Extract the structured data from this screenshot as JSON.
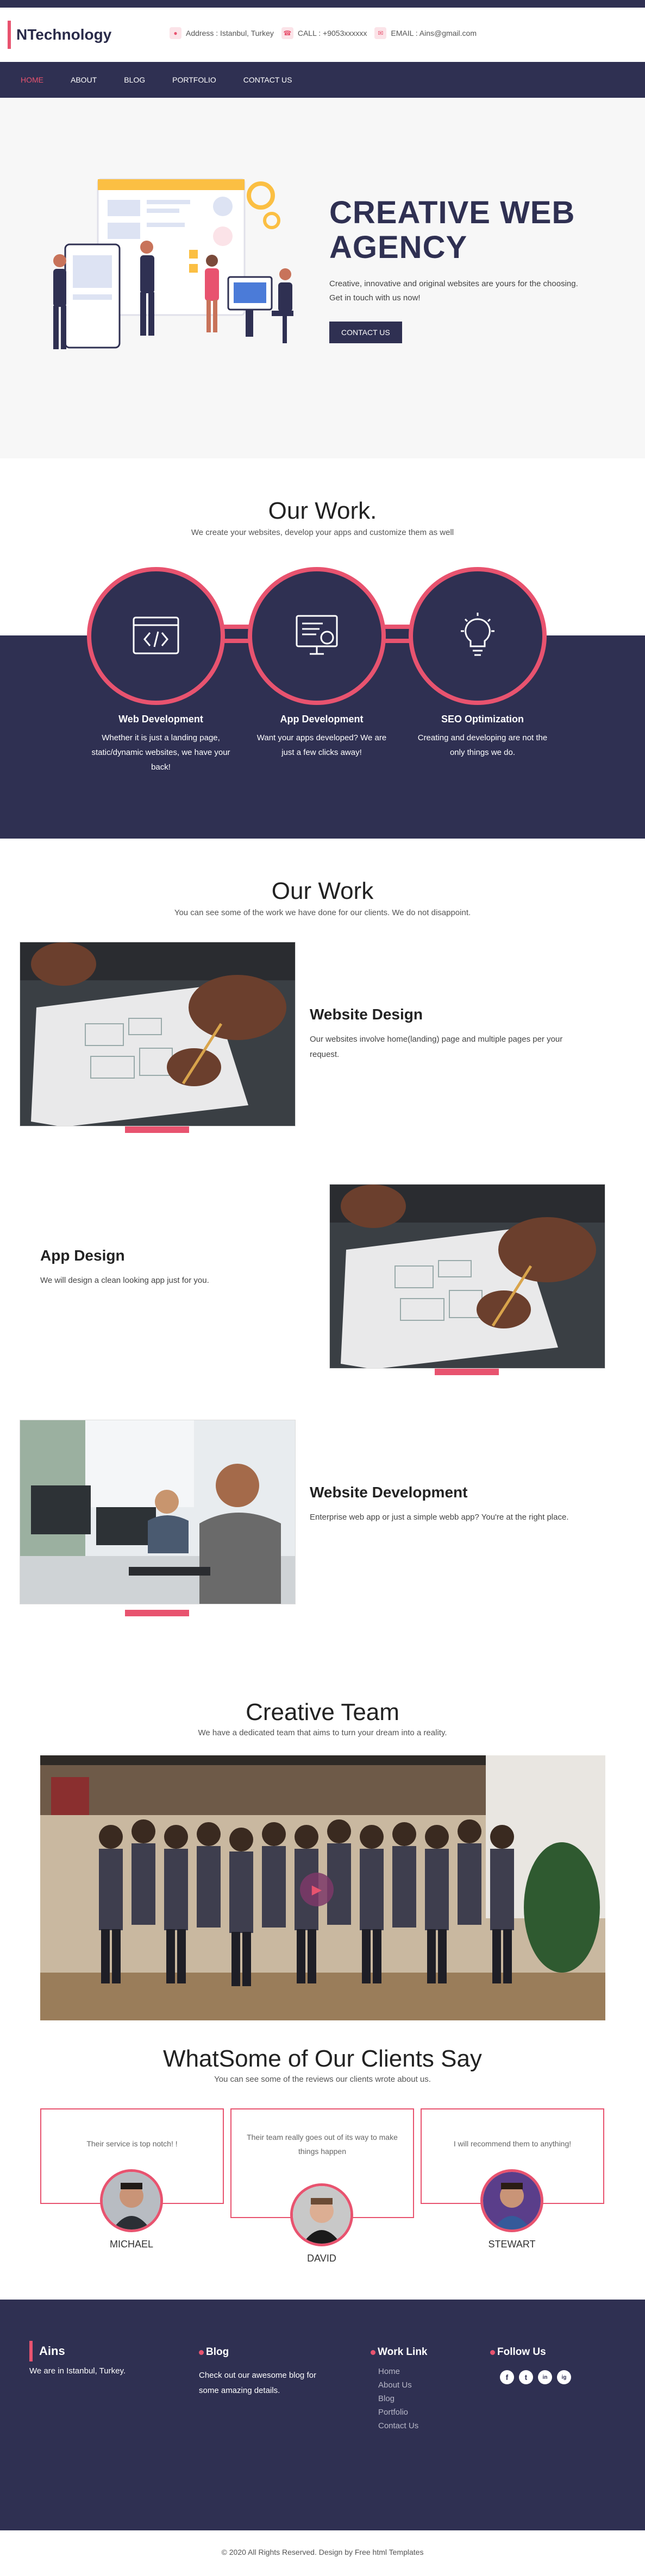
{
  "brand": {
    "name": "NTechnology",
    "accent": "#e8536f",
    "dark": "#2f3052"
  },
  "contacts": [
    {
      "icon": "location-icon",
      "text": "Address : Istanbul, Turkey"
    },
    {
      "icon": "phone-icon",
      "text": "CALL : +9053xxxxxx"
    },
    {
      "icon": "email-icon",
      "text": "EMAIL : Ains@gmail.com"
    }
  ],
  "nav": [
    "HOME",
    "ABOUT",
    "BLOG",
    "PORTFOLIO",
    "CONTACT US"
  ],
  "hero": {
    "title_line1": "CREATIVE WEB",
    "title_line2": "AGENCY",
    "subtitle": "Creative, innovative and original websites are yours for the choosing. Get in touch with us now!",
    "button": "CONTACT US"
  },
  "services": {
    "title": "Our Work.",
    "subtitle": "We create your websites, develop your apps and customize them as well",
    "items": [
      {
        "icon": "code-icon",
        "title": "Web Development",
        "text": "Whether it is just a landing page, static/dynamic websites, we have your back!"
      },
      {
        "icon": "monitor-icon",
        "title": "App Development",
        "text": "Want your apps developed? We are just a few clicks away!"
      },
      {
        "icon": "lightbulb-icon",
        "title": "SEO Optimization",
        "text": "Creating and developing are not the only things we do."
      }
    ]
  },
  "portfolio": {
    "title": "Our Work",
    "subtitle": "You can see some of the work we have done for our clients. We do not disappoint.",
    "items": [
      {
        "title": "Website Design",
        "text": "Our websites involve home(landing) page and multiple pages per your request."
      },
      {
        "title": "App Design",
        "text": "We will design a clean looking app just for you."
      },
      {
        "title": "Website Development",
        "text": "Enterprise web app or just a simple webb app? You're at the right place."
      }
    ]
  },
  "team": {
    "title": "Creative Team",
    "subtitle": "We have a dedicated team that aims to turn your dream into a reality."
  },
  "clients": {
    "title": "WhatSome of Our Clients Say",
    "subtitle": "You can see some of the reviews our clients wrote about us.",
    "items": [
      {
        "quote": "Their service is top notch! !",
        "name": "MICHAEL"
      },
      {
        "quote": "Their team really goes out of its way to make things happen",
        "name": "DAVID"
      },
      {
        "quote": "I will recommend them to anything!",
        "name": "STEWART"
      }
    ]
  },
  "footer": {
    "brand": "Ains",
    "brand_text": "We are in Istanbul, Turkey.",
    "blog_title": "Blog",
    "blog_text": "Check out our awesome blog for some amazing details.",
    "links_title": "Work Link",
    "links": [
      "Home",
      "About Us",
      "Blog",
      "Portfolio",
      "Contact Us"
    ],
    "follow_title": "Follow Us",
    "social": [
      "f",
      "t",
      "in",
      "ig"
    ]
  },
  "copyright": "© 2020 All Rights Reserved. Design by Free html Templates"
}
